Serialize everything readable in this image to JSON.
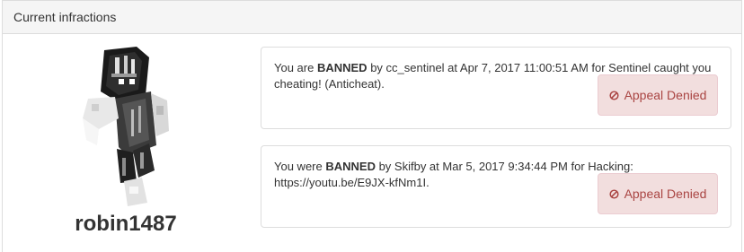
{
  "panel": {
    "title": "Current infractions"
  },
  "player": {
    "username": "robin1487"
  },
  "infractions": [
    {
      "prefix": "You are ",
      "status": "BANNED",
      "text": " by cc_sentinel at Apr 7, 2017 11:00:51 AM for Sentinel caught you cheating! (Anticheat).",
      "appeal_label": "Appeal Denied"
    },
    {
      "prefix": "You were ",
      "status": "BANNED",
      "text": " by Skifby at Mar 5, 2017 9:34:44 PM for Hacking: https://youtu.be/E9JX-kfNm1I.",
      "appeal_label": "Appeal Denied"
    }
  ],
  "colors": {
    "appeal_bg": "#f2dede",
    "appeal_text": "#a94442",
    "heading_bg": "#f5f5f5"
  },
  "icons": {
    "appeal": "ban-icon"
  }
}
